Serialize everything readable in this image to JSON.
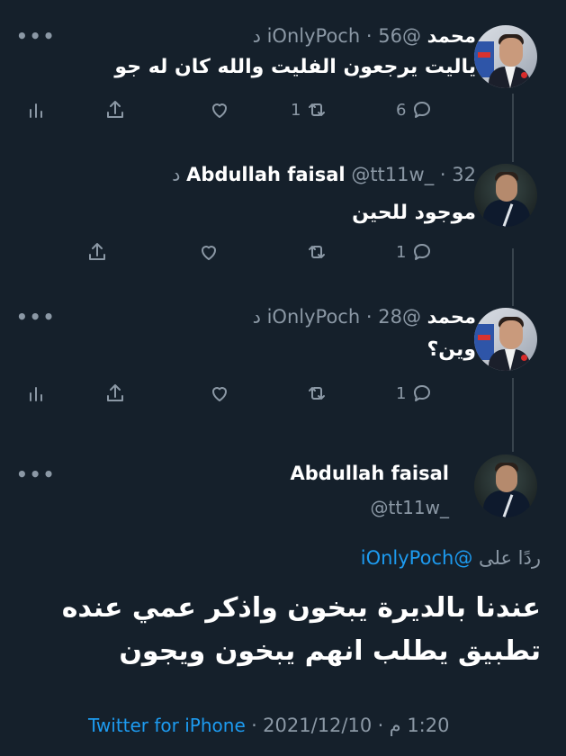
{
  "tweets": [
    {
      "name": "محمد",
      "handle": "@iOnlyPoch",
      "time": "56 د",
      "text": "ياليت يرجعون الفليت والله كان له جو",
      "reply_count": "6",
      "retweet_count": "1",
      "like_count": "",
      "has_analytics": true
    },
    {
      "name": "Abdullah faisal",
      "handle": "@tt11w_",
      "time": "32 د",
      "text": "موجود للحين",
      "reply_count": "1",
      "retweet_count": "",
      "like_count": "",
      "has_analytics": false
    },
    {
      "name": "محمد",
      "handle": "@iOnlyPoch",
      "time": "28 د",
      "text": "وين؟",
      "reply_count": "1",
      "retweet_count": "",
      "like_count": "",
      "has_analytics": true
    }
  ],
  "main": {
    "name": "Abdullah faisal",
    "handle": "@tt11w_",
    "reply_to_label": "ردًا على",
    "reply_to_handle": "@iOnlyPoch",
    "line1": "عندنا بالديرة يبخون واذكر عمي عنده",
    "line2": "تطبيق يطلب انهم يبخون ويجون",
    "time": "1:20 م",
    "date": "2021/12/10",
    "source": "Twitter for iPhone"
  },
  "ui": {
    "more": "•••",
    "separator": "·"
  },
  "colors": {
    "background": "#15202b",
    "accent": "#1d9bf0",
    "muted": "#8b98a5"
  },
  "icons": [
    "reply-icon",
    "retweet-icon",
    "like-icon",
    "share-icon",
    "analytics-icon",
    "more-icon"
  ]
}
